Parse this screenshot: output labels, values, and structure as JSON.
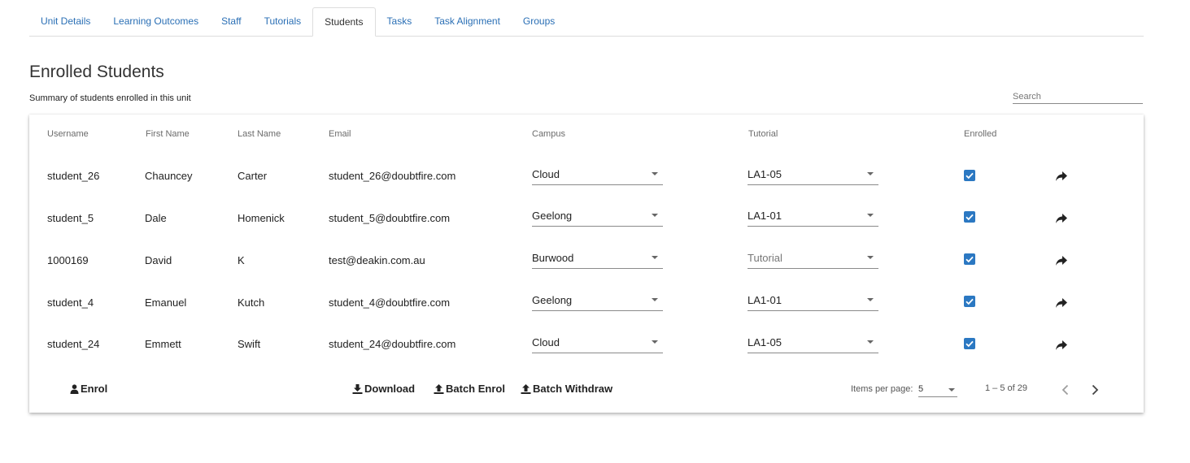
{
  "tabs": [
    {
      "label": "Unit Details",
      "active": false
    },
    {
      "label": "Learning Outcomes",
      "active": false
    },
    {
      "label": "Staff",
      "active": false
    },
    {
      "label": "Tutorials",
      "active": false
    },
    {
      "label": "Students",
      "active": true
    },
    {
      "label": "Tasks",
      "active": false
    },
    {
      "label": "Task Alignment",
      "active": false
    },
    {
      "label": "Groups",
      "active": false
    }
  ],
  "page": {
    "title": "Enrolled Students",
    "subtitle": "Summary of students enrolled in this unit"
  },
  "search": {
    "placeholder": "Search",
    "value": ""
  },
  "table": {
    "headers": {
      "username": "Username",
      "first_name": "First Name",
      "last_name": "Last Name",
      "email": "Email",
      "campus": "Campus",
      "tutorial": "Tutorial",
      "enrolled": "Enrolled"
    },
    "rows": [
      {
        "username": "student_26",
        "first_name": "Chauncey",
        "last_name": "Carter",
        "email": "student_26@doubtfire.com",
        "campus": "Cloud",
        "tutorial": "LA1-05",
        "tutorial_is_placeholder": false,
        "enrolled": true
      },
      {
        "username": "student_5",
        "first_name": "Dale",
        "last_name": "Homenick",
        "email": "student_5@doubtfire.com",
        "campus": "Geelong",
        "tutorial": "LA1-01",
        "tutorial_is_placeholder": false,
        "enrolled": true
      },
      {
        "username": "1000169",
        "first_name": "David",
        "last_name": "K",
        "email": "test@deakin.com.au",
        "campus": "Burwood",
        "tutorial": "Tutorial",
        "tutorial_is_placeholder": true,
        "enrolled": true
      },
      {
        "username": "student_4",
        "first_name": "Emanuel",
        "last_name": "Kutch",
        "email": "student_4@doubtfire.com",
        "campus": "Geelong",
        "tutorial": "LA1-01",
        "tutorial_is_placeholder": false,
        "enrolled": true
      },
      {
        "username": "student_24",
        "first_name": "Emmett",
        "last_name": "Swift",
        "email": "student_24@doubtfire.com",
        "campus": "Cloud",
        "tutorial": "LA1-05",
        "tutorial_is_placeholder": false,
        "enrolled": true
      }
    ]
  },
  "actions": {
    "enrol": "Enrol",
    "download": "Download",
    "batch_enrol": "Batch Enrol",
    "batch_withdraw": "Batch Withdraw"
  },
  "paginator": {
    "items_per_page_label": "Items per page:",
    "page_size": "5",
    "range_label": "1 – 5 of 29"
  },
  "icons": {
    "user": "user-icon",
    "download": "download-icon",
    "upload": "upload-icon",
    "share": "share-icon",
    "chevron_left": "chevron-left-icon",
    "chevron_right": "chevron-right-icon",
    "checkbox_checked": "check-icon"
  },
  "colors": {
    "tab_link": "#2a6fb5",
    "checkbox": "#2b78c2",
    "text": "#222222",
    "muted": "#6b6b6b"
  }
}
